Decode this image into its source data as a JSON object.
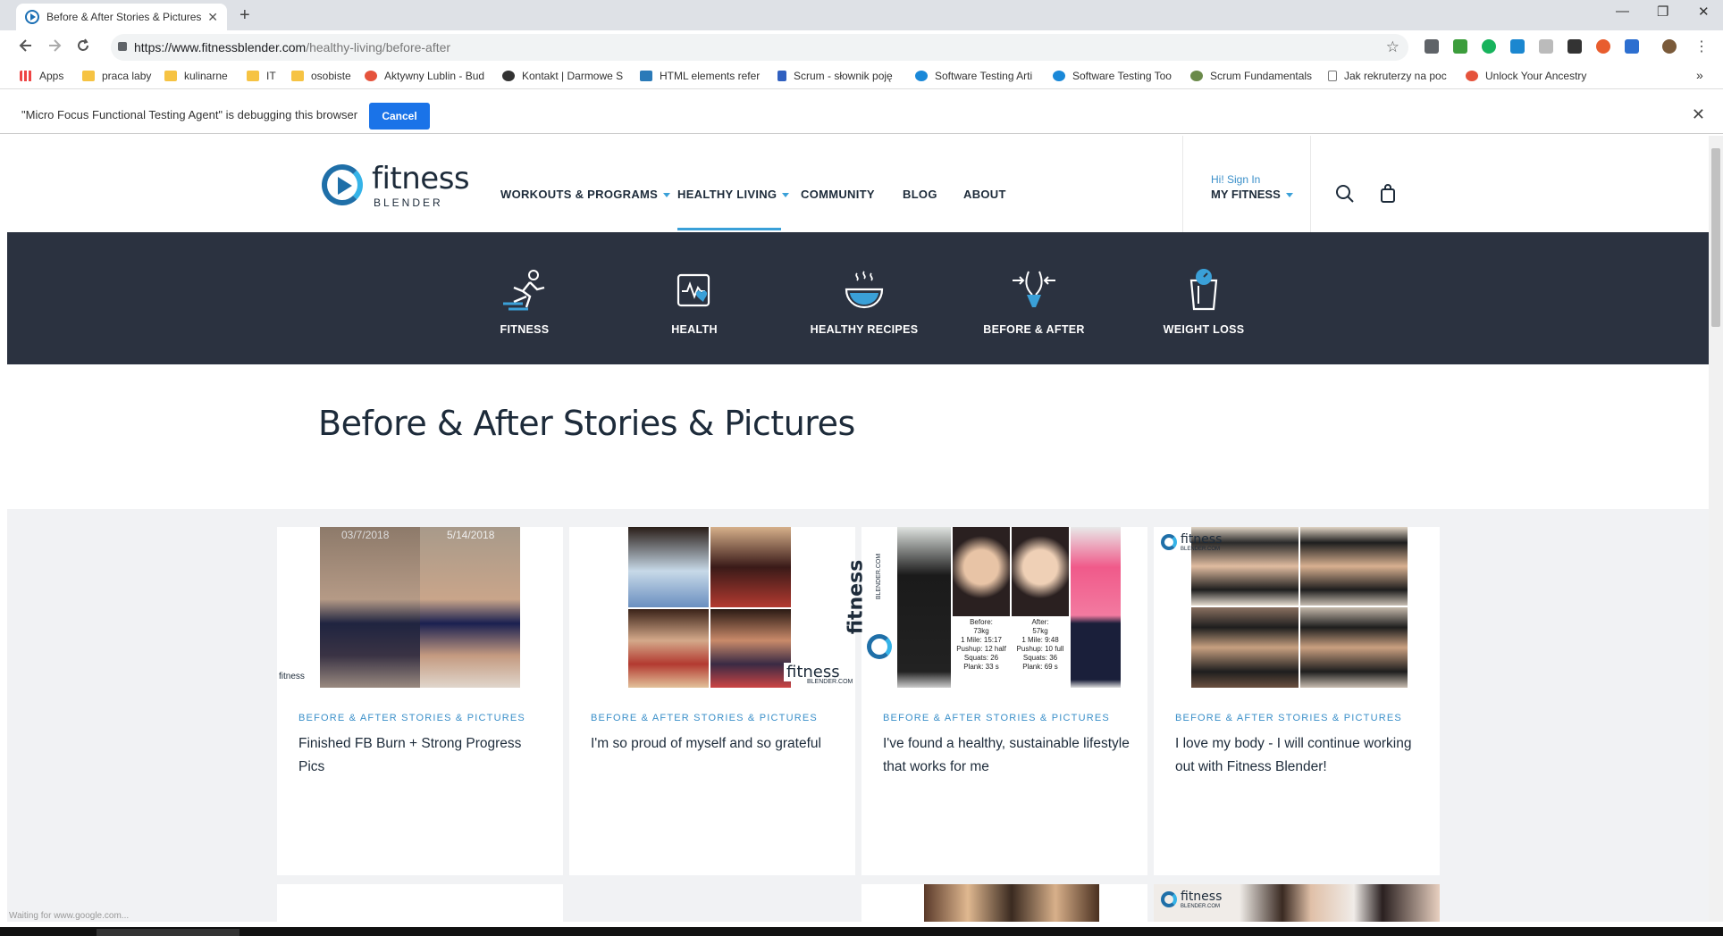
{
  "browser": {
    "tab_title": "Before & After Stories & Pictures",
    "tab_close": "✕",
    "new_tab": "+",
    "url_host": "https://www.fitnessblender.com",
    "url_path": "/healthy-living/before-after",
    "window_controls": [
      "—",
      "❐",
      "✕"
    ],
    "nav_icons": [
      "arrow-left-icon",
      "arrow-right-icon",
      "reload-icon"
    ],
    "bookmarks": [
      {
        "label": "Apps",
        "icon": "apps-grid-icon"
      },
      {
        "label": "praca laby",
        "icon": "folder-icon"
      },
      {
        "label": "kulinarne",
        "icon": "folder-icon"
      },
      {
        "label": "IT",
        "icon": "folder-icon"
      },
      {
        "label": "osobiste",
        "icon": "folder-icon"
      },
      {
        "label": "Aktywny Lublin - Bud",
        "icon": "clock-icon"
      },
      {
        "label": "Kontakt | Darmowe S",
        "icon": "3d-icon"
      },
      {
        "label": "HTML elements refer",
        "icon": "image-icon"
      },
      {
        "label": "Scrum - słownik poję",
        "icon": "link-icon"
      },
      {
        "label": "Software Testing Arti",
        "icon": "u-icon"
      },
      {
        "label": "Software Testing Too",
        "icon": "u-icon"
      },
      {
        "label": "Scrum Fundamentals",
        "icon": "scrum-icon"
      },
      {
        "label": "Jak rekruterzy na poc",
        "icon": "page-icon"
      },
      {
        "label": "Unlock Your Ancestry",
        "icon": "ancestry-icon"
      }
    ],
    "bookmarks_more": "»"
  },
  "debug_bar": {
    "message": "\"Micro Focus Functional Testing Agent\" is debugging this browser",
    "cancel_label": "Cancel",
    "close": "✕"
  },
  "site": {
    "logo_word": "fitness",
    "logo_sub": "BLENDER",
    "nav": [
      {
        "label": "WORKOUTS & PROGRAMS",
        "dropdown": true
      },
      {
        "label": "HEALTHY LIVING",
        "dropdown": true,
        "active": true
      },
      {
        "label": "COMMUNITY",
        "dropdown": false
      },
      {
        "label": "BLOG",
        "dropdown": false
      },
      {
        "label": "ABOUT",
        "dropdown": false
      }
    ],
    "signin_label": "Hi! Sign In",
    "my_fitness_label": "MY FITNESS",
    "icons": [
      "search-icon",
      "shopping-bag-icon"
    ]
  },
  "subnav": [
    {
      "label": "FITNESS",
      "icon": "runner-icon"
    },
    {
      "label": "HEALTH",
      "icon": "heart-monitor-icon"
    },
    {
      "label": "HEALTHY RECIPES",
      "icon": "bowl-icon"
    },
    {
      "label": "BEFORE & AFTER",
      "icon": "body-transform-icon"
    },
    {
      "label": "WEIGHT LOSS",
      "icon": "scale-icon"
    }
  ],
  "page": {
    "heading": "Before & After Stories & Pictures"
  },
  "cards": [
    {
      "category": "BEFORE & AFTER STORIES & PICTURES",
      "title": "Finished FB Burn + Strong Progress Pics",
      "photo_dates": [
        "03/7/2018",
        "5/14/2018"
      ],
      "watermark": "fitness"
    },
    {
      "category": "BEFORE & AFTER STORIES & PICTURES",
      "title": "I'm so proud of myself and so grateful",
      "watermark": "fitness",
      "watermark_sub": "BLENDER.COM"
    },
    {
      "category": "BEFORE & AFTER STORIES & PICTURES",
      "title": "I've found a healthy, sustainable lifestyle that works for me",
      "side_brand": "fitness",
      "side_brand_sub": "BLENDER.COM",
      "stats_before": [
        "Before:",
        "73kg",
        "1 Mile: 15:17",
        "Pushup: 12 half",
        "Squats: 26",
        "Plank: 33 s"
      ],
      "stats_after": [
        "After:",
        "57kg",
        "1 Mile: 9:48",
        "Pushup: 10 full",
        "Squats: 36",
        "Plank: 69 s"
      ]
    },
    {
      "category": "BEFORE & AFTER STORIES & PICTURES",
      "title": "I love my body - I will continue working out with Fitness Blender!",
      "watermark": "fitness",
      "watermark_sub": "BLENDER.COM"
    }
  ],
  "bottom_row": {
    "watermark": "fitness",
    "watermark_sub": "BLENDER.COM"
  },
  "status_text": "Waiting for www.google.com..."
}
